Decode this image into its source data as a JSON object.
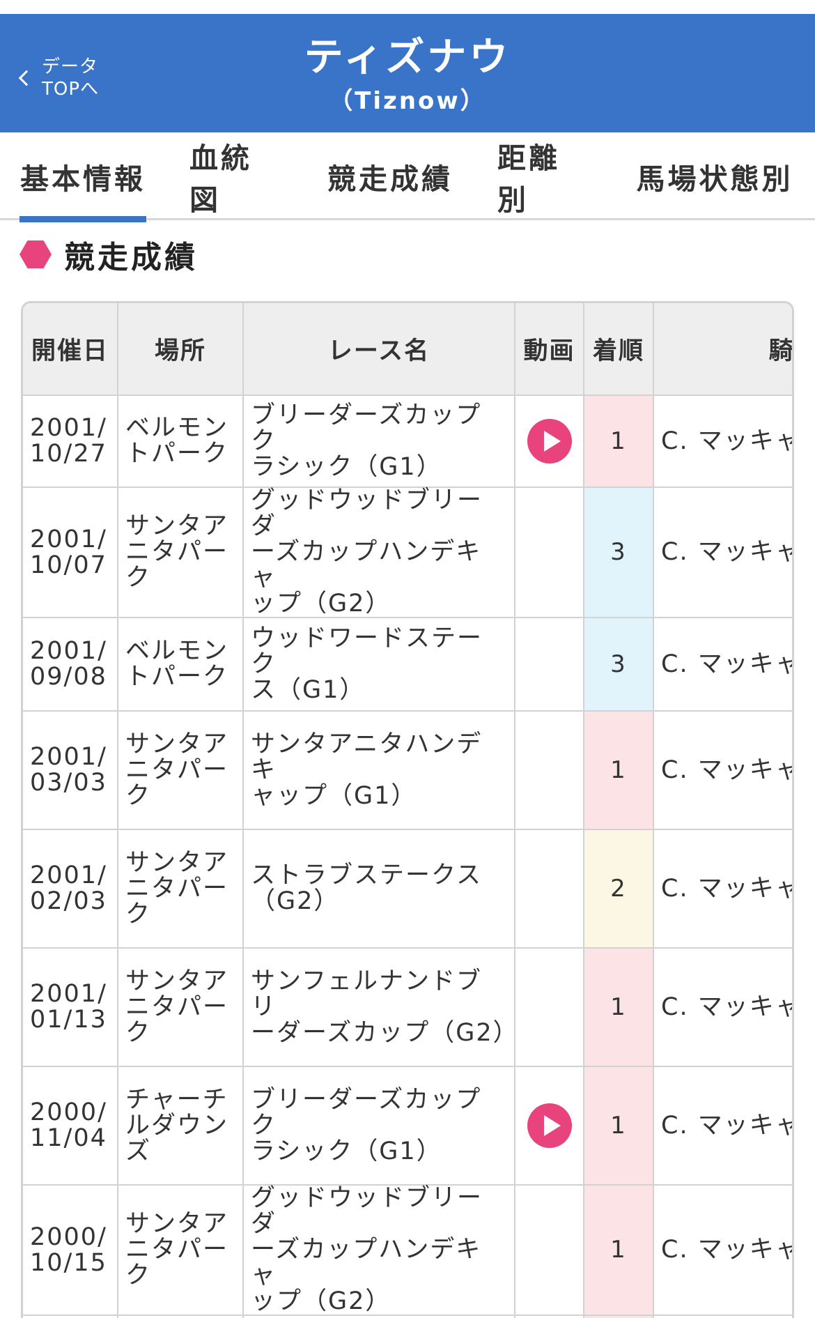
{
  "header": {
    "back_label_line1": "データ",
    "back_label_line2": "TOPへ",
    "title": "ティズナウ",
    "subtitle": "（Tiznow）",
    "background_color": "#3a74c8"
  },
  "tabs": [
    {
      "label": "基本情報",
      "active": true
    },
    {
      "label": "血統図",
      "active": false
    },
    {
      "label": "競走成績",
      "active": false
    },
    {
      "label": "距離別",
      "active": false
    },
    {
      "label": "馬場状態別",
      "active": false
    }
  ],
  "section": {
    "title": "競走成績",
    "icon": "hexagon-icon",
    "accent_color": "#e8437d"
  },
  "table": {
    "headers": {
      "date": "開催日",
      "place": "場所",
      "race": "レース名",
      "video": "動画",
      "rank": "着順",
      "jockey": "騎手"
    },
    "rows": [
      {
        "date1": "2001/",
        "date2": "10/27",
        "place": [
          "ベルモン",
          "トパーク"
        ],
        "race": [
          "ブリーダーズカップク",
          "ラシック（G1）"
        ],
        "video": true,
        "rank": "1",
        "jockey": "C. マッキャロン"
      },
      {
        "date1": "2001/",
        "date2": "10/07",
        "place": [
          "サンタア",
          "ニタパー",
          "ク"
        ],
        "race": [
          "グッドウッドブリーダ",
          "ーズカップハンデキャ",
          "ップ（G2）"
        ],
        "video": false,
        "rank": "3",
        "jockey": "C. マッキャロン"
      },
      {
        "date1": "2001/",
        "date2": "09/08",
        "place": [
          "ベルモン",
          "トパーク"
        ],
        "race": [
          "ウッドワードステーク",
          "ス（G1）"
        ],
        "video": false,
        "rank": "3",
        "jockey": "C. マッキャロン"
      },
      {
        "date1": "2001/",
        "date2": "03/03",
        "place": [
          "サンタア",
          "ニタパー",
          "ク"
        ],
        "race": [
          "サンタアニタハンデキ",
          "ャップ（G1）"
        ],
        "video": false,
        "rank": "1",
        "jockey": "C. マッキャロン"
      },
      {
        "date1": "2001/",
        "date2": "02/03",
        "place": [
          "サンタア",
          "ニタパー",
          "ク"
        ],
        "race": [
          "ストラブステークス",
          "（G2）"
        ],
        "video": false,
        "rank": "2",
        "jockey": "C. マッキャロン"
      },
      {
        "date1": "2001/",
        "date2": "01/13",
        "place": [
          "サンタア",
          "ニタパー",
          "ク"
        ],
        "race": [
          "サンフェルナンドブリ",
          "ーダーズカップ（G2）"
        ],
        "video": false,
        "rank": "1",
        "jockey": "C. マッキャロン"
      },
      {
        "date1": "2000/",
        "date2": "11/04",
        "place": [
          "チャーチ",
          "ルダウン",
          "ズ"
        ],
        "race": [
          "ブリーダーズカップク",
          "ラシック（G1）"
        ],
        "video": true,
        "rank": "1",
        "jockey": "C. マッキャロン"
      },
      {
        "date1": "2000/",
        "date2": "10/15",
        "place": [
          "サンタア",
          "ニタパー",
          "ク"
        ],
        "race": [
          "グッドウッドブリーダ",
          "ーズカップハンデキャ",
          "ップ（G2）"
        ],
        "video": false,
        "rank": "1",
        "jockey": "C. マッキャロン"
      }
    ]
  }
}
